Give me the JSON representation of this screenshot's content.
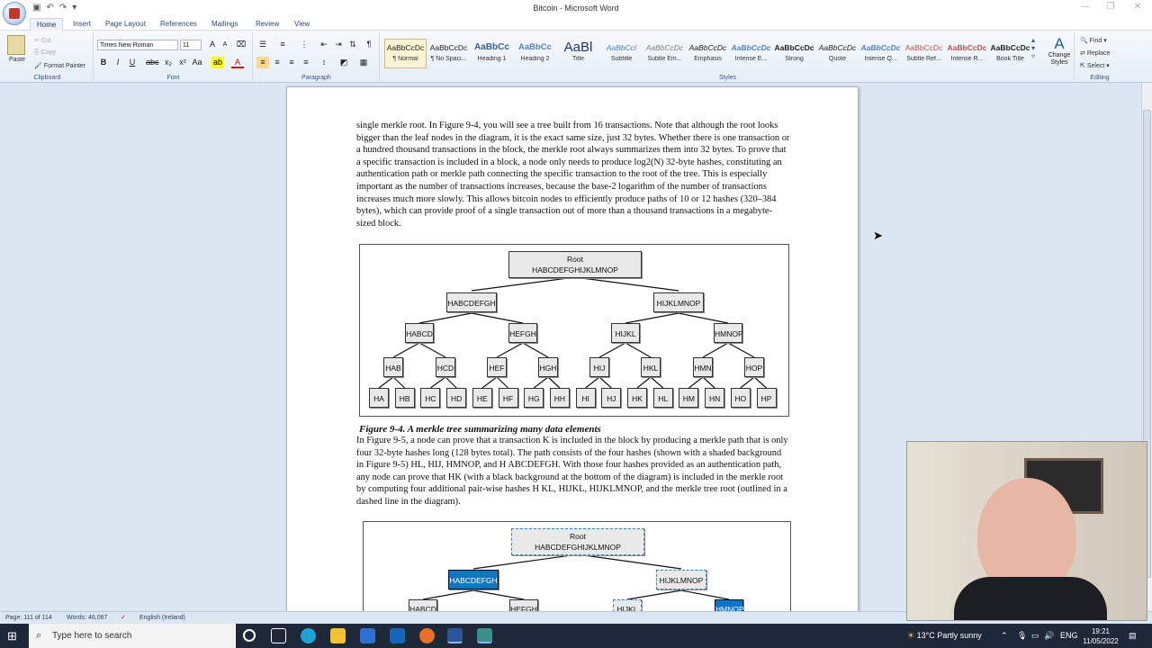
{
  "window": {
    "title": "Bitcoin - Microsoft Word"
  },
  "tabs": [
    "Home",
    "Insert",
    "Page Layout",
    "References",
    "Mailings",
    "Review",
    "View"
  ],
  "clipboard": {
    "paste": "Paste",
    "cut": "Cut",
    "copy": "Copy",
    "format_painter": "Format Painter",
    "label": "Clipboard"
  },
  "font": {
    "name": "Times New Roman",
    "size": "11",
    "label": "Font"
  },
  "paragraph": {
    "label": "Paragraph"
  },
  "styles": {
    "label": "Styles",
    "items": [
      {
        "preview": "AaBbCcDc",
        "name": "¶ Normal"
      },
      {
        "preview": "AaBbCcDc",
        "name": "¶ No Spaci..."
      },
      {
        "preview": "AaBbCc",
        "name": "Heading 1"
      },
      {
        "preview": "AaBbCc",
        "name": "Heading 2"
      },
      {
        "preview": "AaBl",
        "name": "Title"
      },
      {
        "preview": "AaBbCcI",
        "name": "Subtitle"
      },
      {
        "preview": "AaBbCcDc",
        "name": "Subtle Em..."
      },
      {
        "preview": "AaBbCcDc",
        "name": "Emphasis"
      },
      {
        "preview": "AaBbCcDc",
        "name": "Intense E..."
      },
      {
        "preview": "AaBbCcDc",
        "name": "Strong"
      },
      {
        "preview": "AaBbCcDc",
        "name": "Quote"
      },
      {
        "preview": "AaBbCcDc",
        "name": "Intense Q..."
      },
      {
        "preview": "AaBbCcDc",
        "name": "Subtle Ref..."
      },
      {
        "preview": "AaBbCcDc",
        "name": "Intense R..."
      },
      {
        "preview": "AaBbCcDc",
        "name": "Book Title"
      }
    ],
    "change_styles": "Change Styles"
  },
  "editing": {
    "find": "Find",
    "replace": "Replace",
    "select": "Select",
    "label": "Editing"
  },
  "document": {
    "para1": "single merkle root. In Figure 9-4, you will see a tree built from 16 transactions. Note that although the root looks bigger than the leaf nodes in the diagram, it is the exact same size, just 32 bytes. Whether there is one transaction or a hundred thousand transactions in the block, the merkle root always summarizes them into 32 bytes. To prove that a specific transaction is included in a block, a node only needs to produce log2(N) 32-byte hashes, constituting an authentication path or merkle path connecting the specific transaction to the root of the tree. This is especially important as the number of transactions increases, because the base-2 logarithm of the number of transactions increases much more slowly. This allows bitcoin nodes to efficiently produce paths of 10 or 12 hashes (320–384 bytes), which can provide proof of a single transaction out of more than a thousand transactions in a megabyte-sized block.",
    "caption": "Figure 9-4. A merkle tree summarizing many data elements",
    "para2": "In Figure 9-5, a node can prove that a transaction K is included in the block by producing a merkle path that is only four 32-byte hashes long (128 bytes total). The path consists of the four hashes (shown with a shaded background in Figure 9-5) HL, HIJ, HMNOP, and H ABCDEFGH. With those four hashes provided as an authentication path, any node can prove that HK (with a black background at the bottom of the diagram) is included in the merkle root by computing four additional pair-wise hashes H KL, HIJKL, HIJKLMNOP, and the merkle tree root (outlined in a dashed line in the diagram).",
    "fig1": {
      "root_label": "Root",
      "root_hash": "HABCDEFGHIJKLMNOP",
      "level1": [
        "HABCDEFGH",
        "HIJKLMNOP"
      ],
      "level2": [
        "HABCD",
        "HEFGH",
        "HIJKL",
        "HMNOP"
      ],
      "level3": [
        "HAB",
        "HCD",
        "HEF",
        "HGH",
        "HIJ",
        "HKL",
        "HMN",
        "HOP"
      ],
      "leaves": [
        "HA",
        "HB",
        "HC",
        "HD",
        "HE",
        "HF",
        "HG",
        "HH",
        "HI",
        "HJ",
        "HK",
        "HL",
        "HM",
        "HN",
        "HO",
        "HP"
      ]
    },
    "fig2": {
      "root_label": "Root",
      "root_hash": "HABCDEFGHIJKLMNOP",
      "level1": [
        "HABCDEFGH",
        "HIJKLMNOP"
      ],
      "level2": [
        "HABCD",
        "HEFGH",
        "HIJKL",
        "HMNOP"
      ]
    }
  },
  "status": {
    "page": "Page: 111 of 114",
    "words": "Words: 46,067",
    "language": "English (Ireland)"
  },
  "taskbar": {
    "search_placeholder": "Type here to search",
    "weather": "13°C  Partly sunny",
    "lang": "ENG",
    "time": "19:21",
    "date": "11/05/2022"
  }
}
